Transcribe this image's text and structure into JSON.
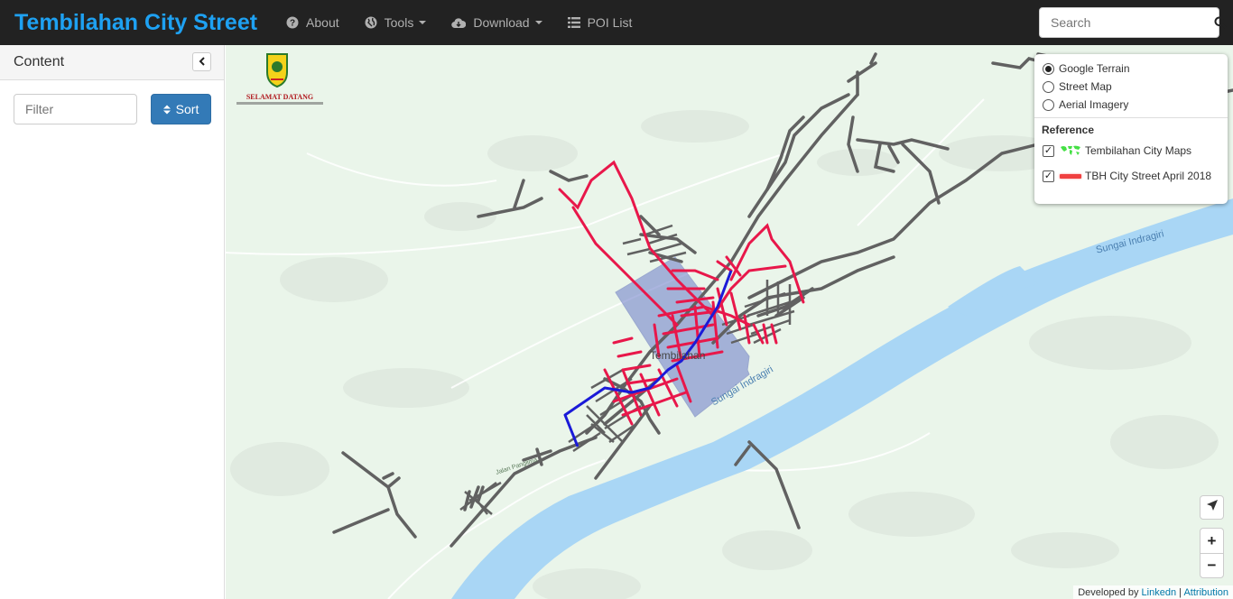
{
  "app": {
    "title": "Tembilahan City Street"
  },
  "nav": {
    "about": "About",
    "tools": "Tools",
    "download": "Download",
    "poi": "POI List"
  },
  "search": {
    "placeholder": "Search"
  },
  "sidebar": {
    "title": "Content",
    "filter_placeholder": "Filter",
    "sort_label": "Sort"
  },
  "map": {
    "logo_text": "SELAMAT DATANG",
    "labels": {
      "city": "Tembilahan",
      "river_main": "Sungai Indragiri",
      "river_upper": "Sungai Indragiri"
    },
    "colors": {
      "water": "#a9d6f5",
      "land": "#eaf5ea",
      "street_red": "#e8174a",
      "street_gray": "#616161",
      "street_blue": "#1a1ad8",
      "overlay": "#6a7ac8"
    }
  },
  "layers": {
    "base": [
      {
        "label": "Google Terrain",
        "selected": true
      },
      {
        "label": "Street Map",
        "selected": false
      },
      {
        "label": "Aerial Imagery",
        "selected": false
      }
    ],
    "reference_title": "Reference",
    "overlays": [
      {
        "label": "Tembilahan City Maps",
        "checked": true,
        "icon": "world-map-icon"
      },
      {
        "label": "TBH City Street April 2018",
        "checked": true,
        "icon": "red-line-icon"
      }
    ]
  },
  "controls": {
    "locate": "locate-arrow-icon",
    "zoom_in": "+",
    "zoom_out": "−"
  },
  "attribution": {
    "prefix": "Developed by",
    "linkedin": "Linkedn",
    "separator": "|",
    "attribution": "Attribution"
  }
}
